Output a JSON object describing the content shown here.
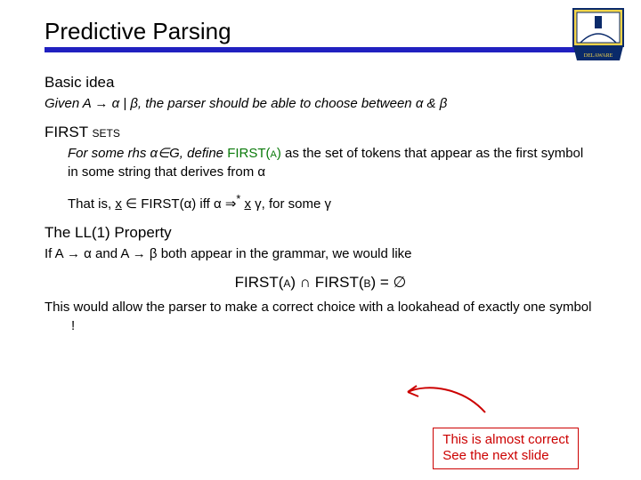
{
  "title": "Predictive Parsing",
  "sections": {
    "basic_idea": {
      "heading": "Basic idea",
      "line": "Given A → α | β, the parser should be able to choose between α & β"
    },
    "first_sets": {
      "heading": "FIRST sets",
      "line1a": "For some rhs α∈G, define ",
      "line1b": "FIRST(α)",
      "line1c": " as the set of tokens that appear as the first symbol in some string that derives from α",
      "line2_pre": "That is, ",
      "line2_x1": "x",
      "line2_mid1": " ∈ FIRST(α) iff  α ⇒",
      "line2_star": "*",
      "line2_mid2": " ",
      "line2_x2": "x",
      "line2_post": " γ,  for some γ"
    },
    "ll1": {
      "heading": "The LL(1)  Property",
      "line1": "If A → α and A → β both appear in the grammar, we would like",
      "equation": "FIRST(α) ∩ FIRST(β) = ∅",
      "line2": "This would allow the parser to make a correct choice with a lookahead of exactly one symbol !"
    }
  },
  "callout": {
    "line1": "This is almost correct",
    "line2": "See the next slide"
  }
}
